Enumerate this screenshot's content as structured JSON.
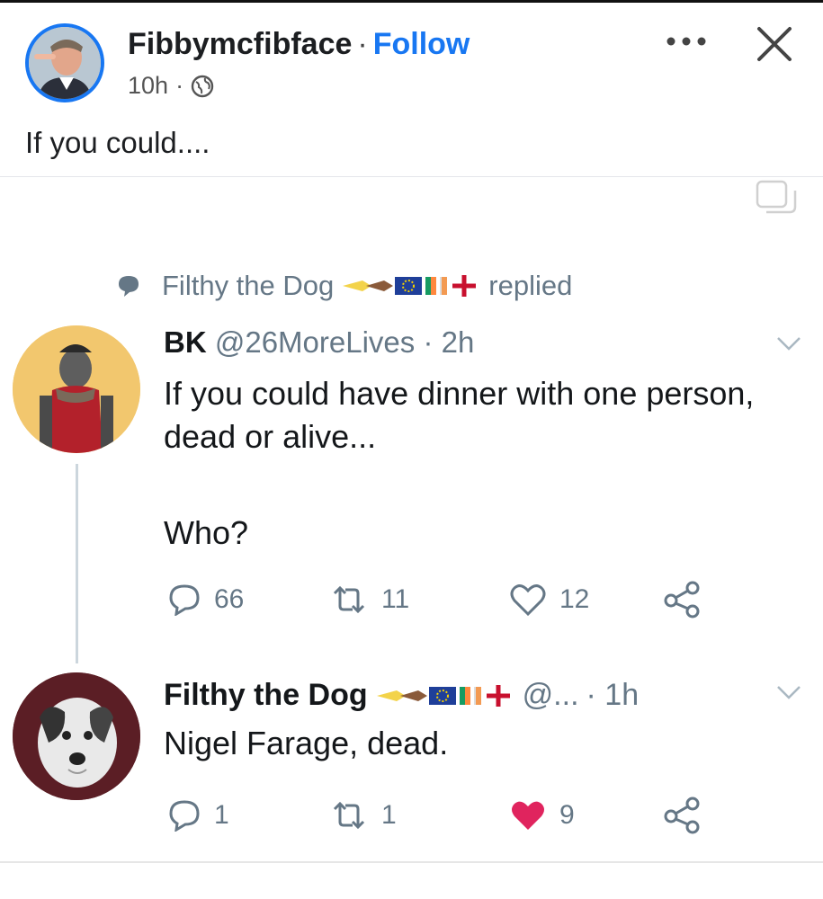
{
  "fb_post": {
    "author": "Fibbymcfibface",
    "separator": "·",
    "follow_label": "Follow",
    "time": "10h",
    "meta_separator": "·",
    "text": "If you could...."
  },
  "tweet_context": {
    "replier": "Filthy the Dog",
    "action": "replied"
  },
  "tweet1": {
    "name": "BK",
    "handle": "@26MoreLives",
    "time": "· 2h",
    "body": "If you could have dinner with one person, dead or alive...",
    "question": "Who?",
    "replies": "66",
    "retweets": "11",
    "likes": "12"
  },
  "tweet2": {
    "name": "Filthy the Dog",
    "handle": "@...",
    "time": "· 1h",
    "body": "Nigel Farage, dead.",
    "replies": "1",
    "retweets": "1",
    "likes": "9"
  },
  "colors": {
    "fb_blue": "#1877f2",
    "tw_grey": "#657786",
    "like_red": "#e0245e"
  }
}
